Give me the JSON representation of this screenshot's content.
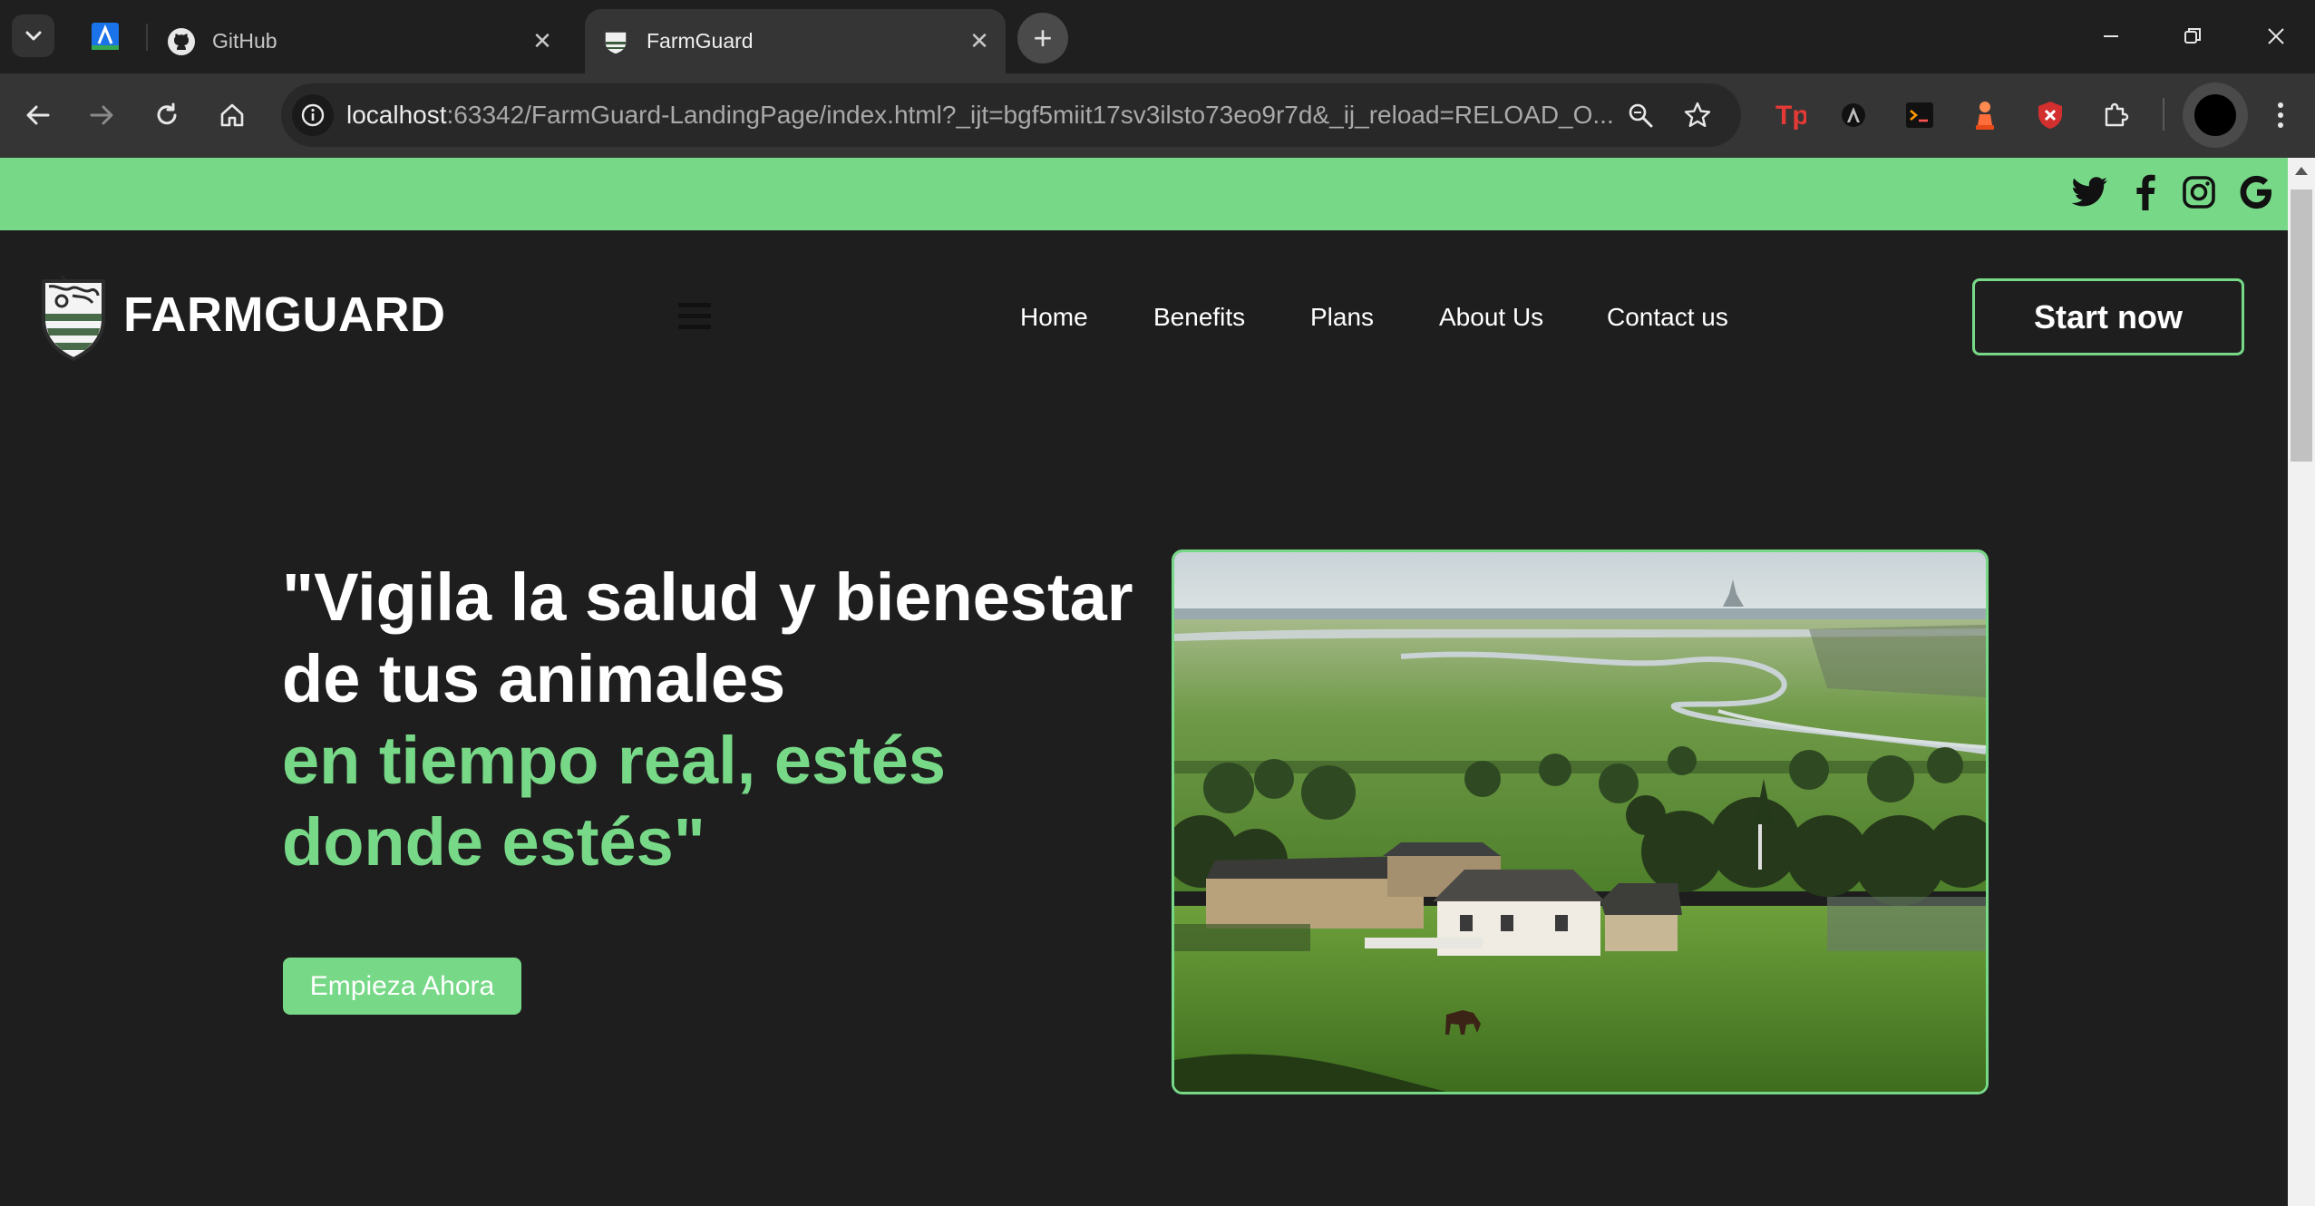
{
  "browser": {
    "tabs": [
      {
        "title": "GitHub",
        "active": false
      },
      {
        "title": "FarmGuard",
        "active": true
      }
    ],
    "url_host": "localhost",
    "url_rest": ":63342/FarmGuard-LandingPage/index.html?_ijt=bgf5miit17sv3ilsto73eo9r7d&_ij_reload=RELOAD_O...",
    "extensions": [
      "tp-extension-icon",
      "angular-devtools-icon",
      "terminal-extension-icon",
      "chess-pawn-extension-icon",
      "shield-blocker-icon",
      "puzzle-extensions-icon"
    ]
  },
  "site": {
    "social": [
      "twitter-icon",
      "facebook-icon",
      "instagram-icon",
      "google-icon"
    ],
    "brand": "FARMGUARD",
    "nav": [
      {
        "label": "Home"
      },
      {
        "label": "Benefits"
      },
      {
        "label": "Plans"
      },
      {
        "label": "About Us"
      },
      {
        "label": "Contact us"
      }
    ],
    "start_button": "Start now",
    "hero": {
      "line1": "\"Vigila la salud y bienestar",
      "line2": "de tus animales",
      "line3": "en tiempo real, estés",
      "line4": "donde estés\"",
      "cta": "Empieza Ahora"
    }
  },
  "colors": {
    "accent": "#77d987",
    "background": "#1e1e1e",
    "text": "#ffffff"
  }
}
